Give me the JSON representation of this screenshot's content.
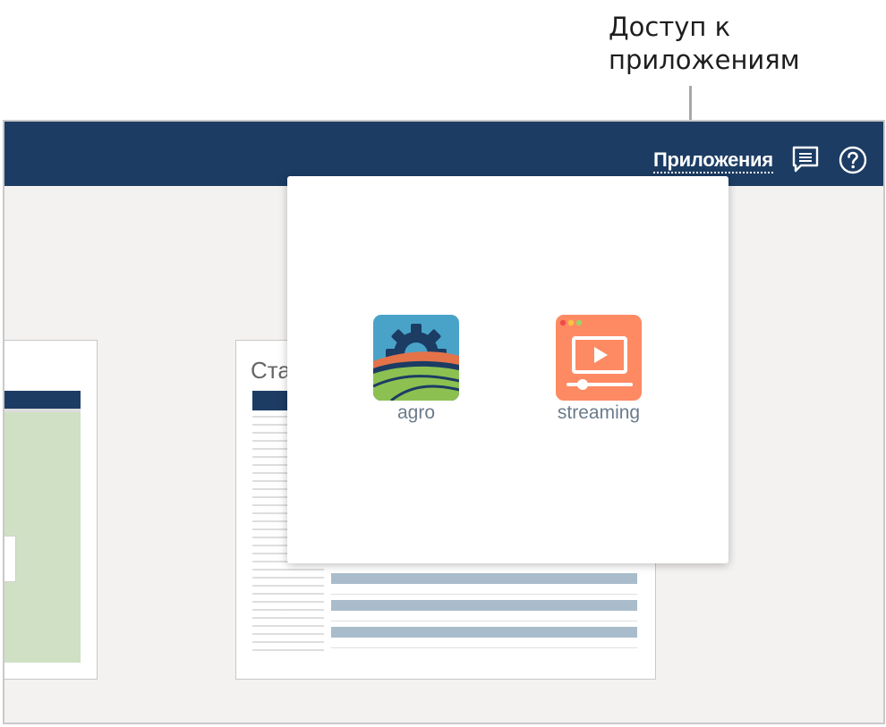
{
  "annotation": {
    "line1": "Доступ к",
    "line2": "приложениям"
  },
  "header": {
    "apps_label": "Приложения",
    "chat_icon": "message-icon",
    "help_icon": "help-icon"
  },
  "background": {
    "tile_title": "Стат"
  },
  "apps_popup": {
    "apps": [
      {
        "label": "agro",
        "icon": "agro-field-gear-icon"
      },
      {
        "label": "streaming",
        "icon": "video-player-icon"
      }
    ]
  },
  "colors": {
    "header_bg": "#1c3c63",
    "agro_accent": "#49a3c9",
    "streaming_accent": "#fe8a63"
  }
}
